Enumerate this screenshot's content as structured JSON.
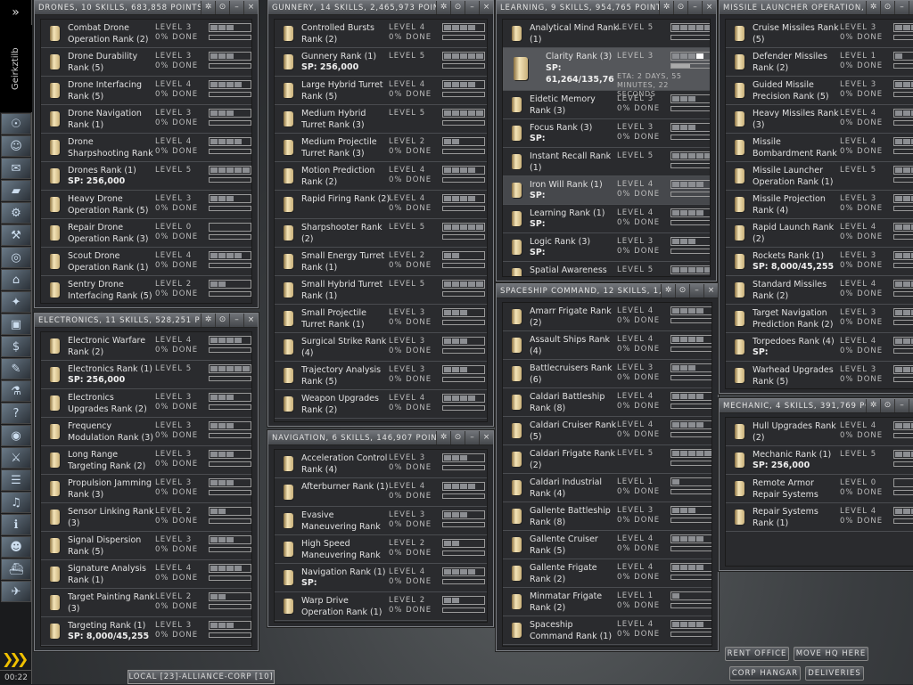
{
  "sidebar": {
    "character_name": "Geirkztilb",
    "toggle_icon": "double-chevron-right-icon",
    "clock": "00:22",
    "icons": [
      "character-sheet-icon",
      "people-icon",
      "mail-icon",
      "notepad-icon",
      "market-icon",
      "industry-icon",
      "map-icon",
      "corporation-icon",
      "starmap-icon",
      "assets-icon",
      "wallet-icon",
      "contracts-icon",
      "science-icon",
      "help-icon",
      "overview-icon",
      "fitting-icon",
      "journal-icon",
      "music-icon",
      "info-icon",
      "portrait-icon",
      "ships-icon",
      "drones-icon"
    ]
  },
  "window_buttons": {
    "pin": "✲",
    "settings": "⊙",
    "minimize": "–",
    "close": "×"
  },
  "windows": [
    {
      "id": "drones",
      "title": "DRONES, 10 SKILLS, 683,858 POINTS",
      "items": [
        {
          "name": "Combat Drone Operation Rank (2)",
          "level": 3,
          "done": "0% DONE"
        },
        {
          "name": "Drone Durability Rank (5)",
          "level": 3,
          "done": "0% DONE"
        },
        {
          "name": "Drone Interfacing Rank (5)",
          "level": 4,
          "done": "0% DONE"
        },
        {
          "name": "Drone Navigation Rank (1)",
          "level": 3,
          "done": "0% DONE"
        },
        {
          "name": "Drone Sharpshooting Rank (1)",
          "level": 4,
          "done": "0% DONE"
        },
        {
          "name": "Drones Rank (1)",
          "level": 5,
          "sp": "SP: 256,000"
        },
        {
          "name": "Heavy Drone Operation Rank (5)",
          "level": 3,
          "done": "0% DONE"
        },
        {
          "name": "Repair Drone Operation Rank (3)",
          "level": 0,
          "done": "0% DONE"
        },
        {
          "name": "Scout Drone Operation Rank (1)",
          "level": 4,
          "done": "0% DONE"
        },
        {
          "name": "Sentry Drone Interfacing Rank (5)",
          "level": 2,
          "done": "0% DONE"
        }
      ]
    },
    {
      "id": "electronics",
      "title": "ELECTRONICS, 11 SKILLS, 528,251 POINTS",
      "items": [
        {
          "name": "Electronic Warfare Rank (2)",
          "level": 4,
          "done": "0% DONE"
        },
        {
          "name": "Electronics Rank (1)",
          "level": 5,
          "sp": "SP: 256,000"
        },
        {
          "name": "Electronics Upgrades Rank (2)",
          "level": 3,
          "done": "0% DONE"
        },
        {
          "name": "Frequency Modulation Rank (3)",
          "level": 3,
          "done": "0% DONE"
        },
        {
          "name": "Long Range Targeting Rank (2)",
          "level": 3,
          "done": "0% DONE"
        },
        {
          "name": "Propulsion Jamming Rank (3)",
          "level": 3,
          "done": "0% DONE"
        },
        {
          "name": "Sensor Linking Rank (3)",
          "level": 2,
          "done": "0% DONE"
        },
        {
          "name": "Signal Dispersion Rank (5)",
          "level": 3,
          "done": "0% DONE"
        },
        {
          "name": "Signature Analysis Rank (1)",
          "level": 4,
          "done": "0% DONE"
        },
        {
          "name": "Target Painting Rank (3)",
          "level": 2,
          "done": "0% DONE"
        },
        {
          "name": "Targeting Rank (1)",
          "level": 3,
          "done": "0% DONE",
          "sp": "SP: 8,000/45,255"
        }
      ]
    },
    {
      "id": "gunnery",
      "title": "GUNNERY, 14 SKILLS, 2,465,973 POINTS",
      "items": [
        {
          "name": "Controlled Bursts Rank (2)",
          "level": 4,
          "done": "0% DONE"
        },
        {
          "name": "Gunnery Rank (1)",
          "level": 5,
          "sp": "SP: 256,000"
        },
        {
          "name": "Large Hybrid Turret Rank (5)",
          "level": 4,
          "done": "0% DONE"
        },
        {
          "name": "Medium Hybrid Turret Rank (3)",
          "level": 5
        },
        {
          "name": "Medium Projectile Turret Rank (3)",
          "level": 2,
          "done": "0% DONE"
        },
        {
          "name": "Motion Prediction Rank (2)",
          "level": 4,
          "done": "0% DONE"
        },
        {
          "name": "Rapid Firing Rank (2)",
          "level": 4,
          "done": "0% DONE"
        },
        {
          "name": "Sharpshooter Rank (2)",
          "level": 5
        },
        {
          "name": "Small Energy Turret Rank (1)",
          "level": 2,
          "done": "0% DONE"
        },
        {
          "name": "Small Hybrid Turret Rank (1)",
          "level": 5
        },
        {
          "name": "Small Projectile Turret Rank (1)",
          "level": 3,
          "done": "0% DONE"
        },
        {
          "name": "Surgical Strike Rank (4)",
          "level": 3,
          "done": "0% DONE"
        },
        {
          "name": "Trajectory Analysis Rank (5)",
          "level": 3,
          "done": "0% DONE"
        },
        {
          "name": "Weapon Upgrades Rank (2)",
          "level": 4,
          "done": "0% DONE"
        }
      ]
    },
    {
      "id": "navigation",
      "title": "NAVIGATION, 6 SKILLS, 146,907 POINTS",
      "items": [
        {
          "name": "Acceleration Control Rank (4)",
          "level": 3,
          "done": "0% DONE"
        },
        {
          "name": "Afterburner Rank (1)",
          "level": 4,
          "done": "0% DONE"
        },
        {
          "name": "Evasive Maneuvering Rank (2)",
          "level": 3,
          "done": "0% DONE"
        },
        {
          "name": "High Speed Maneuvering Rank",
          "level": 2,
          "done": "0% DONE"
        },
        {
          "name": "Navigation Rank (1)",
          "level": 4,
          "done": "0% DONE",
          "sp": "SP:"
        },
        {
          "name": "Warp Drive Operation Rank (1)",
          "level": 2,
          "done": "0% DONE"
        }
      ]
    },
    {
      "id": "learning",
      "title": "LEARNING, 9 SKILLS, 954,765 POINTS (",
      "items": [
        {
          "name": "Analytical Mind Rank (1)",
          "level": 5
        },
        {
          "name": "Clarity Rank (3)",
          "level": 3,
          "sp": "SP: 61,264/135,76",
          "eta": "ETA: 2 DAYS, 55 MINUTES, 22 SECONDS",
          "training": true,
          "progress": 0.45
        },
        {
          "name": "Eidetic Memory Rank (3)",
          "level": 3,
          "done": "0% DONE"
        },
        {
          "name": "Focus Rank (3)",
          "level": 3,
          "done": "0% DONE",
          "sp": "SP:"
        },
        {
          "name": "Instant Recall Rank (1)",
          "level": 5
        },
        {
          "name": "Iron Will Rank (1)",
          "level": 4,
          "done": "0% DONE",
          "sp": "SP:",
          "selected": true
        },
        {
          "name": "Learning Rank (1)",
          "level": 4,
          "done": "0% DONE",
          "sp": "SP:"
        },
        {
          "name": "Logic Rank (3)",
          "level": 3,
          "done": "0% DONE",
          "sp": "SP:"
        },
        {
          "name": "Spatial Awareness",
          "level": 5
        }
      ]
    },
    {
      "id": "spaceship",
      "title": "SPACESHIP COMMAND, 12 SKILLS, 1,84",
      "items": [
        {
          "name": "Amarr Frigate Rank (2)",
          "level": 4,
          "done": "0% DONE"
        },
        {
          "name": "Assault Ships Rank (4)",
          "level": 4,
          "done": "0% DONE"
        },
        {
          "name": "Battlecruisers Rank (6)",
          "level": 3,
          "done": "0% DONE"
        },
        {
          "name": "Caldari Battleship Rank (8)",
          "level": 4,
          "done": "0% DONE"
        },
        {
          "name": "Caldari Cruiser Rank (5)",
          "level": 4,
          "done": "0% DONE"
        },
        {
          "name": "Caldari Frigate Rank (2)",
          "level": 5
        },
        {
          "name": "Caldari Industrial Rank (4)",
          "level": 1,
          "done": "0% DONE"
        },
        {
          "name": "Gallente Battleship Rank (8)",
          "level": 3,
          "done": "0% DONE"
        },
        {
          "name": "Gallente Cruiser Rank (5)",
          "level": 4,
          "done": "0% DONE"
        },
        {
          "name": "Gallente Frigate Rank (2)",
          "level": 4,
          "done": "0% DONE"
        },
        {
          "name": "Minmatar Frigate Rank (2)",
          "level": 1,
          "done": "0% DONE"
        },
        {
          "name": "Spaceship Command Rank (1)",
          "level": 4,
          "done": "0% DONE"
        }
      ]
    },
    {
      "id": "missile",
      "title": "MISSILE LAUNCHER OPERATION, 13 SKIL",
      "items": [
        {
          "name": "Cruise Missiles Rank (5)",
          "level": 3,
          "done": "0% DONE"
        },
        {
          "name": "Defender Missiles Rank (2)",
          "level": 1,
          "done": "0% DONE"
        },
        {
          "name": "Guided Missile Precision Rank (5)",
          "level": 3,
          "done": "0% DONE"
        },
        {
          "name": "Heavy Missiles Rank (3)",
          "level": 4,
          "done": "0% DONE"
        },
        {
          "name": "Missile Bombardment Rank (2)",
          "level": 4,
          "done": "0% DONE"
        },
        {
          "name": "Missile Launcher Operation Rank (1)",
          "level": 5
        },
        {
          "name": "Missile Projection Rank (4)",
          "level": 3,
          "done": "0% DONE"
        },
        {
          "name": "Rapid Launch Rank (2)",
          "level": 4,
          "done": "0% DONE"
        },
        {
          "name": "Rockets Rank (1)",
          "level": 3,
          "done": "0% DONE",
          "sp": "SP: 8,000/45,255"
        },
        {
          "name": "Standard Missiles Rank (2)",
          "level": 4,
          "done": "0% DONE"
        },
        {
          "name": "Target Navigation Prediction Rank (2)",
          "level": 3,
          "done": "0% DONE"
        },
        {
          "name": "Torpedoes Rank (4)",
          "level": 4,
          "done": "0% DONE",
          "sp": "SP:"
        },
        {
          "name": "Warhead Upgrades Rank (5)",
          "level": 3,
          "done": "0% DONE"
        }
      ]
    },
    {
      "id": "mechanic",
      "title": "MECHANIC, 4 SKILLS, 391,769 POINTS",
      "items": [
        {
          "name": "Hull Upgrades Rank (2)",
          "level": 4,
          "done": "0% DONE"
        },
        {
          "name": "Mechanic Rank (1)",
          "level": 5,
          "sp": "SP: 256,000"
        },
        {
          "name": "Remote Armor Repair Systems",
          "level": 0,
          "done": "0% DONE"
        },
        {
          "name": "Repair Systems Rank (1)",
          "level": 4,
          "done": "0% DONE"
        }
      ]
    }
  ],
  "level_prefix": "LEVEL",
  "chat": {
    "channel": "LOCAL [23]-ALLIANCE-CORP [10]"
  },
  "station": {
    "rent_office": "RENT OFFICE",
    "move_hq": "MOVE HQ HERE",
    "corp_hangar": "CORP HANGAR",
    "deliveries": "DELIVERIES"
  }
}
